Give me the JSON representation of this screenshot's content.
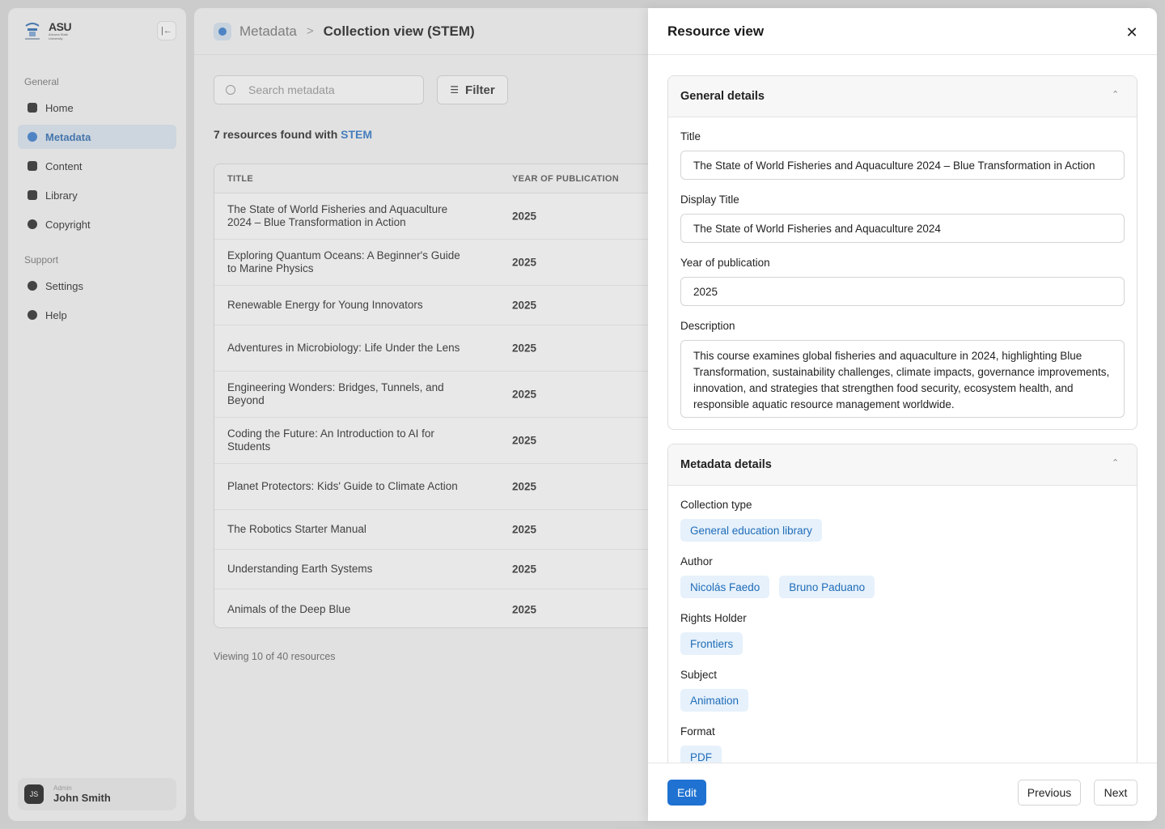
{
  "brand": {
    "logo_text": "ASU",
    "logo_subtext": "Arizona State University"
  },
  "sidebar": {
    "general_label": "General",
    "support_label": "Support",
    "general_items": [
      {
        "label": "Home",
        "icon": "home-icon",
        "active": false
      },
      {
        "label": "Metadata",
        "icon": "tag-icon",
        "active": true
      },
      {
        "label": "Content",
        "icon": "database-icon",
        "active": false
      },
      {
        "label": "Library",
        "icon": "book-icon",
        "active": false
      },
      {
        "label": "Copyright",
        "icon": "copyright-icon",
        "active": false
      }
    ],
    "support_items": [
      {
        "label": "Settings",
        "icon": "gear-icon"
      },
      {
        "label": "Help",
        "icon": "help-icon"
      }
    ],
    "user": {
      "initials": "JS",
      "role": "Admin",
      "name": "John Smith"
    }
  },
  "header": {
    "breadcrumb_root": "Metadata",
    "breadcrumb_sep": ">",
    "breadcrumb_current": "Collection view (STEM)"
  },
  "search": {
    "placeholder": "Search metadata"
  },
  "filter": {
    "label": "Filter"
  },
  "results": {
    "prefix": "7 resources found with",
    "tag": "STEM"
  },
  "table": {
    "columns": [
      "TITLE",
      "YEAR OF PUBLICATION"
    ],
    "rows": [
      {
        "title": "The State of World Fisheries and Aquaculture 2024 – Blue Transformation in Action",
        "year": "2025"
      },
      {
        "title": "Exploring Quantum Oceans: A Beginner's Guide to Marine Physics",
        "year": "2025"
      },
      {
        "title": "Renewable Energy for Young Innovators",
        "year": "2025"
      },
      {
        "title": "Adventures in Microbiology: Life Under the Lens",
        "year": "2025"
      },
      {
        "title": "Engineering Wonders: Bridges, Tunnels, and Beyond",
        "year": "2025"
      },
      {
        "title": "Coding the Future: An Introduction to AI for Students",
        "year": "2025"
      },
      {
        "title": "Planet Protectors: Kids' Guide to Climate Action",
        "year": "2025"
      },
      {
        "title": "The Robotics Starter Manual",
        "year": "2025"
      },
      {
        "title": "Understanding Earth Systems",
        "year": "2025"
      },
      {
        "title": "Animals of the Deep Blue",
        "year": "2025"
      }
    ]
  },
  "pagination": {
    "summary": "Viewing 10 of 40 resources"
  },
  "drawer": {
    "title": "Resource view",
    "close_icon": "close-icon",
    "general": {
      "heading": "General details",
      "title_label": "Title",
      "title_value": "The State of World Fisheries and Aquaculture 2024 – Blue Transformation in Action",
      "display_title_label": "Display Title",
      "display_title_value": "The State of World Fisheries and Aquaculture 2024",
      "year_label": "Year of publication",
      "year_value": "2025",
      "description_label": "Description",
      "description_value": "This course examines global fisheries and aquaculture in 2024, highlighting Blue Transformation, sustainability challenges, climate impacts, governance improvements, innovation, and strategies that strengthen food security, ecosystem health, and responsible aquatic resource management worldwide."
    },
    "metadata": {
      "heading": "Metadata details",
      "collection_type_label": "Collection type",
      "collection_type": [
        "General education library"
      ],
      "author_label": "Author",
      "authors": [
        "Nicolás Faedo",
        "Bruno Paduano"
      ],
      "rights_holder_label": "Rights Holder",
      "rights_holders": [
        "Frontiers"
      ],
      "subject_label": "Subject",
      "subjects": [
        "Animation"
      ],
      "format_label": "Format",
      "formats": [
        "PDF"
      ]
    },
    "footer": {
      "edit": "Edit",
      "previous": "Previous",
      "next": "Next"
    }
  },
  "colors": {
    "accent": "#1f72d1",
    "chip_bg": "#e6f1fb",
    "chip_text": "#1f6cb8",
    "active_nav_bg": "#dde7f3"
  }
}
